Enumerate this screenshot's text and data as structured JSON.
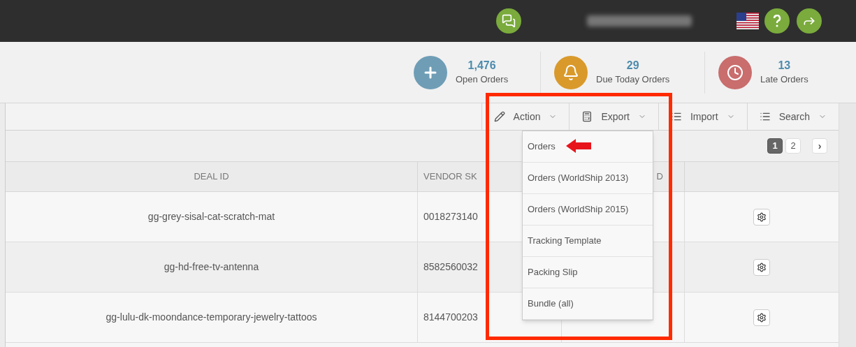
{
  "stats": [
    {
      "kind": "open",
      "count": "1,476",
      "label": "Open Orders"
    },
    {
      "kind": "due",
      "count": "29",
      "label": "Due Today Orders"
    },
    {
      "kind": "late",
      "count": "13",
      "label": "Late Orders"
    }
  ],
  "toolbar": [
    {
      "kind": "action",
      "label": "Action"
    },
    {
      "kind": "export",
      "label": "Export"
    },
    {
      "kind": "import",
      "label": "Import"
    },
    {
      "kind": "search",
      "label": "Search"
    }
  ],
  "export_menu": [
    "Orders",
    "Orders (WorldShip 2013)",
    "Orders (WorldShip 2015)",
    "Tracking Template",
    "Packing Slip",
    "Bundle (all)"
  ],
  "pagination": {
    "pages": [
      {
        "label": "1",
        "selected": true
      },
      {
        "label": "2",
        "selected": false
      }
    ],
    "next": "›"
  },
  "table": {
    "columns": [
      "DEAL ID",
      "VENDOR SK",
      "D"
    ],
    "rows": [
      {
        "deal_id": "gg-grey-sisal-cat-scratch-mat",
        "vendor_sku": "0018273140"
      },
      {
        "deal_id": "gg-hd-free-tv-antenna",
        "vendor_sku": "8582560032"
      },
      {
        "deal_id": "gg-lulu-dk-moondance-temporary-jewelry-tattoos",
        "vendor_sku": "8144700203"
      }
    ]
  }
}
